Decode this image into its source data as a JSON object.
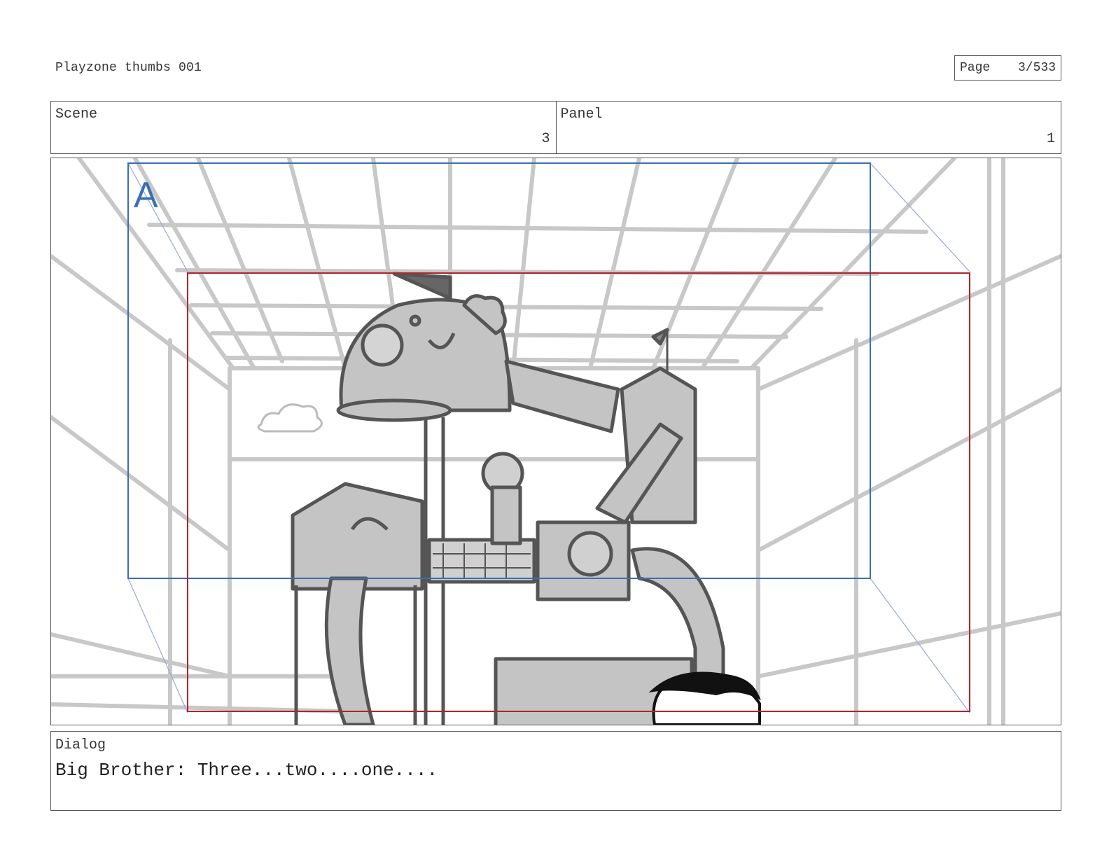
{
  "document": {
    "title": "Playzone thumbs 001",
    "page_label": "Page",
    "page_number": "3/533"
  },
  "info": {
    "scene_label": "Scene",
    "scene_value": "3",
    "panel_label": "Panel",
    "panel_value": "1"
  },
  "panel": {
    "camera_label": "A",
    "colors": {
      "camera_frame_a": "#3a6fb5",
      "camera_frame_b": "#b0242b",
      "sketch_light": "#c8c8c8",
      "sketch_dark": "#555555",
      "sketch_fill": "#c4c4c4"
    }
  },
  "dialog": {
    "label": "Dialog",
    "text": "Big Brother: Three...two....one...."
  }
}
